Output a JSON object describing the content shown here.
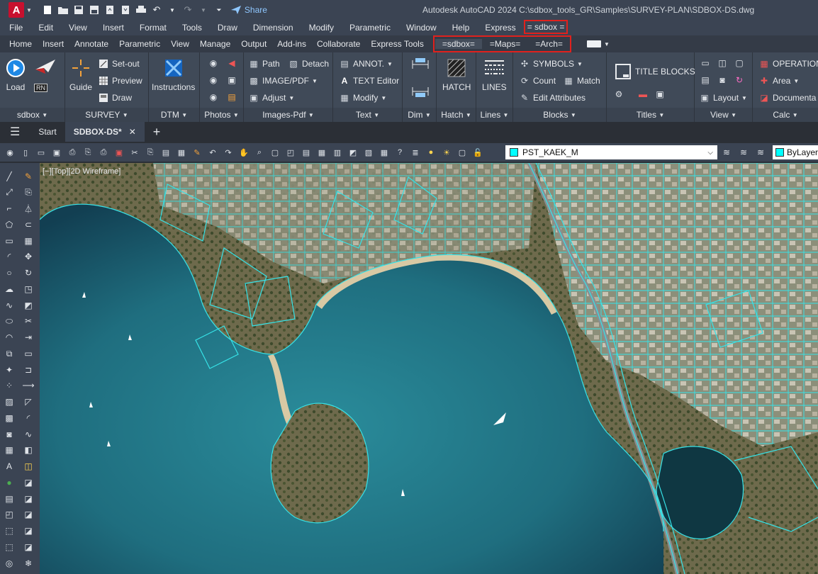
{
  "titlebar": {
    "app_logo": "A",
    "share_label": "Share",
    "title": "Autodesk AutoCAD 2024    C:\\sdbox_tools_GR\\Samples\\SURVEY-PLAN\\SDBOX-DS.dwg"
  },
  "menu": [
    "File",
    "Edit",
    "View",
    "Insert",
    "Format",
    "Tools",
    "Draw",
    "Dimension",
    "Modify",
    "Parametric",
    "Window",
    "Help",
    "Express"
  ],
  "menu_highlight": "= sdbox =",
  "tabs": [
    "Home",
    "Insert",
    "Annotate",
    "Parametric",
    "View",
    "Manage",
    "Output",
    "Add-ins",
    "Collaborate",
    "Express Tools"
  ],
  "tabs_highlight": [
    "=sdbox=",
    "=Maps=",
    "=Arch="
  ],
  "ribbon": {
    "sdbox": {
      "load": "Load",
      "rn": "RN",
      "label": "sdbox"
    },
    "survey": {
      "guide": "Guide",
      "setout": "Set-out",
      "preview": "Preview",
      "draw": "Draw",
      "label": "SURVEY"
    },
    "dtm": {
      "instructions": "Instructions",
      "label": "DTM"
    },
    "photos": {
      "label": "Photos"
    },
    "images": {
      "path": "Path",
      "detach": "Detach",
      "imagepdf": "IMAGE/PDF",
      "adjust": "Adjust",
      "label": "Images-Pdf"
    },
    "text": {
      "annot": "ANNOT.",
      "editor": "TEXT Editor",
      "modify": "Modify",
      "label": "Text"
    },
    "dim": {
      "label": "Dim"
    },
    "hatch": {
      "btn": "HATCH",
      "label": "Hatch"
    },
    "lines": {
      "btn": "LINES",
      "label": "Lines"
    },
    "blocks": {
      "symbols": "SYMBOLS",
      "count": "Count",
      "match": "Match",
      "edit": "Edit Attributes",
      "label": "Blocks"
    },
    "titles": {
      "btn": "TITLE BLOCKS",
      "label": "Titles"
    },
    "view": {
      "layout": "Layout",
      "label": "View"
    },
    "calc": {
      "operation": "OPERATION",
      "area": "Area",
      "document": "Documenta",
      "label": "Calc"
    }
  },
  "doc_tabs": {
    "start": "Start",
    "active": "SDBOX-DS*"
  },
  "layer": {
    "name": "PST_KAEK_M",
    "color": "#00ffff",
    "bylayer": "ByLayer"
  },
  "viewport": {
    "label": "[−][Top][2D Wireframe]"
  },
  "colors": {
    "accent_red": "#e0211d",
    "parcel_lines": "#36e3e8",
    "sea": "#1f6e7f"
  }
}
